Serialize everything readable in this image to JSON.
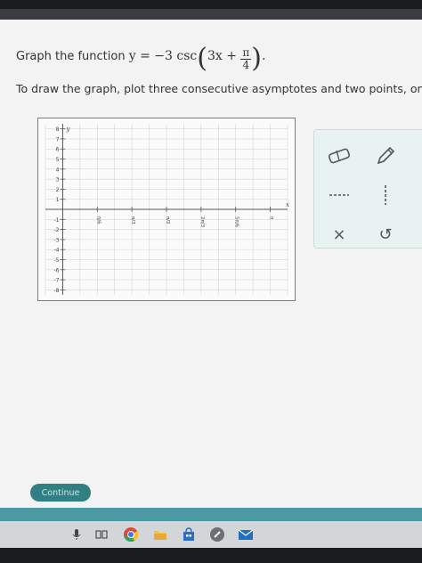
{
  "question": {
    "prefix": "Graph the function",
    "equation": {
      "lhs": "y = −3 csc",
      "inner": "3x +",
      "frac_num": "π",
      "frac_den": "4",
      "suffix": "."
    },
    "instruction": "To draw the graph, plot three consecutive asymptotes and two points, one o"
  },
  "graph": {
    "x_axis_label": "x",
    "y_axis_label": "y",
    "y_ticks": [
      "8",
      "7",
      "6",
      "5",
      "4",
      "3",
      "2",
      "1",
      "-1",
      "-2",
      "-3",
      "-4",
      "-5",
      "-6",
      "-7",
      "-8"
    ],
    "x_ticks": [
      "π/6",
      "π/3",
      "π/2",
      "2π/3",
      "5π/6",
      "π"
    ],
    "x_range": [
      -0.5,
      6.5
    ],
    "y_range": [
      -8.5,
      8.5
    ],
    "grid": true
  },
  "tools": {
    "eraser_icon": "eraser-icon",
    "pencil_icon": "pencil-icon",
    "close_label": "×",
    "undo_label": "↺",
    "help_label": "?"
  },
  "footer": {
    "continue_label": "Continue"
  },
  "colors": {
    "continue_bg": "#2f7f83",
    "footer_bar": "#4b9aa4",
    "grid_line": "#cfcfcf"
  }
}
